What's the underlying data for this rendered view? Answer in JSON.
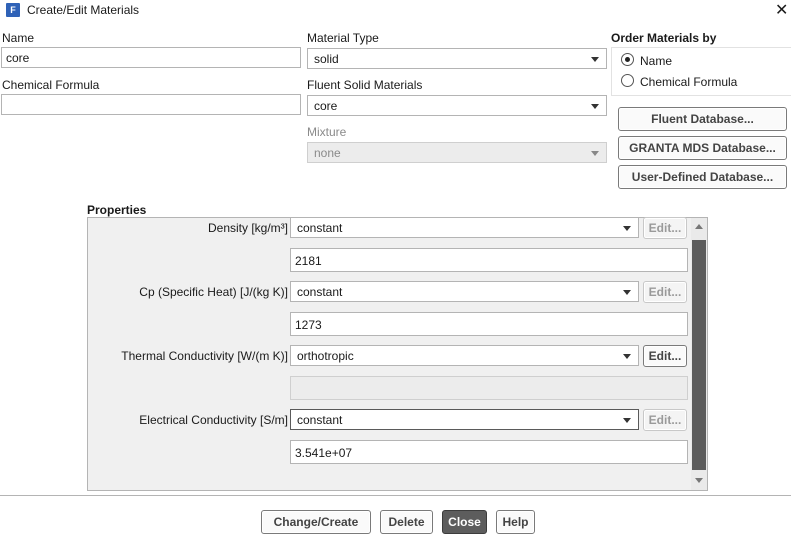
{
  "window": {
    "title": "Create/Edit Materials",
    "app_icon_letter": "F"
  },
  "name": {
    "label": "Name",
    "value": "core"
  },
  "chemical_formula": {
    "label": "Chemical Formula",
    "value": ""
  },
  "material_type": {
    "label": "Material Type",
    "value": "solid"
  },
  "fluent_solid_materials": {
    "label": "Fluent Solid Materials",
    "value": "core"
  },
  "mixture": {
    "label": "Mixture",
    "value": "none"
  },
  "order_by": {
    "label": "Order Materials by",
    "options": [
      {
        "label": "Name",
        "checked": true
      },
      {
        "label": "Chemical Formula",
        "checked": false
      }
    ]
  },
  "database_buttons": {
    "fluent": "Fluent Database...",
    "granta": "GRANTA MDS Database...",
    "user_defined": "User-Defined Database..."
  },
  "properties": {
    "label": "Properties",
    "edit_label": "Edit...",
    "density": {
      "label": "Density [kg/m³]",
      "method": "constant",
      "value": "2181"
    },
    "cp": {
      "label": "Cp (Specific Heat) [J/(kg K)]",
      "method": "constant",
      "value": "1273"
    },
    "thermal": {
      "label": "Thermal Conductivity [W/(m K)]",
      "method": "orthotropic",
      "value": ""
    },
    "electrical": {
      "label": "Electrical Conductivity [S/m]",
      "method": "constant",
      "value": "3.541e+07"
    }
  },
  "footer": {
    "change_create": "Change/Create",
    "delete": "Delete",
    "close": "Close",
    "help": "Help"
  }
}
